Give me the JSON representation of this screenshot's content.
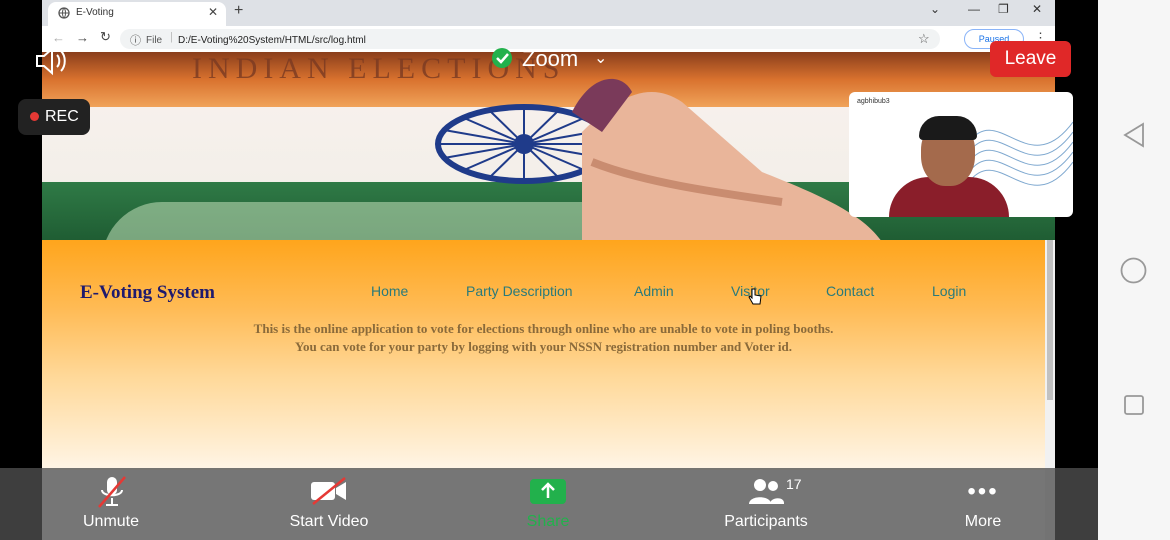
{
  "browser": {
    "tab_title": "E-Voting",
    "tab_close": "✕",
    "new_tab": "+",
    "file_label": "File",
    "url": "D:/E-Voting%20System/HTML/src/log.html",
    "paused_label": "Paused"
  },
  "banner": {
    "title": "INDIAN ELECTIONS"
  },
  "site": {
    "logo": "E-Voting System",
    "nav": [
      "Home",
      "Party Description",
      "Admin",
      "Visitor",
      "Contact",
      "Login"
    ],
    "description_line1": "This is the online application to vote for elections through online who are unable to vote in poling booths.",
    "description_line2": "You can vote for your party by logging with your NSSN registration number and Voter id."
  },
  "zoom": {
    "title": "Zoom",
    "leave_label": "Leave",
    "rec_label": "REC",
    "video_tile_brand": "agbhibub3",
    "toolbar": {
      "unmute": "Unmute",
      "start_video": "Start Video",
      "share": "Share",
      "participants": "Participants",
      "participants_count": "17",
      "more": "More"
    },
    "colors": {
      "leave": "#e02828",
      "share": "#22b14c",
      "secure_check": "#22b14c"
    }
  }
}
